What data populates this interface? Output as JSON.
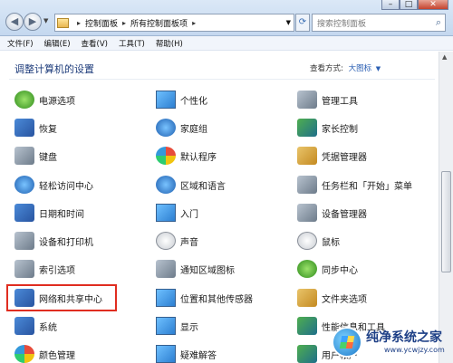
{
  "address_bar": {
    "crumbs": [
      "控制面板",
      "所有控制面板项"
    ],
    "search_placeholder": "搜索控制面板"
  },
  "menu": [
    "文件(F)",
    "编辑(E)",
    "查看(V)",
    "工具(T)",
    "帮助(H)"
  ],
  "content": {
    "heading": "调整计算机的设置",
    "view_by_label": "查看方式:",
    "view_by_value": "大图标"
  },
  "items": [
    {
      "label": "电源选项",
      "icon": "power-options-icon"
    },
    {
      "label": "个性化",
      "icon": "personalization-icon"
    },
    {
      "label": "管理工具",
      "icon": "admin-tools-icon"
    },
    {
      "label": "恢复",
      "icon": "recovery-icon"
    },
    {
      "label": "家庭组",
      "icon": "homegroup-icon"
    },
    {
      "label": "家长控制",
      "icon": "parental-controls-icon"
    },
    {
      "label": "键盘",
      "icon": "keyboard-icon"
    },
    {
      "label": "默认程序",
      "icon": "default-programs-icon"
    },
    {
      "label": "凭据管理器",
      "icon": "credential-manager-icon"
    },
    {
      "label": "轻松访问中心",
      "icon": "ease-of-access-icon"
    },
    {
      "label": "区域和语言",
      "icon": "region-language-icon"
    },
    {
      "label": "任务栏和「开始」菜单",
      "icon": "taskbar-start-icon"
    },
    {
      "label": "日期和时间",
      "icon": "date-time-icon"
    },
    {
      "label": "入门",
      "icon": "getting-started-icon"
    },
    {
      "label": "设备管理器",
      "icon": "device-manager-icon"
    },
    {
      "label": "设备和打印机",
      "icon": "devices-printers-icon"
    },
    {
      "label": "声音",
      "icon": "sound-icon"
    },
    {
      "label": "鼠标",
      "icon": "mouse-icon"
    },
    {
      "label": "索引选项",
      "icon": "indexing-options-icon"
    },
    {
      "label": "通知区域图标",
      "icon": "notification-icons-icon"
    },
    {
      "label": "同步中心",
      "icon": "sync-center-icon"
    },
    {
      "label": "网络和共享中心",
      "icon": "network-sharing-icon"
    },
    {
      "label": "位置和其他传感器",
      "icon": "location-sensors-icon"
    },
    {
      "label": "文件夹选项",
      "icon": "folder-options-icon"
    },
    {
      "label": "系统",
      "icon": "system-icon"
    },
    {
      "label": "显示",
      "icon": "display-icon"
    },
    {
      "label": "性能信息和工具",
      "icon": "performance-icon"
    },
    {
      "label": "颜色管理",
      "icon": "color-management-icon"
    },
    {
      "label": "疑难解答",
      "icon": "troubleshooting-icon"
    },
    {
      "label": "用户帐户",
      "icon": "user-accounts-icon"
    }
  ],
  "watermark": {
    "title": "纯净系统之家",
    "url": "www.ycwjzy.com"
  }
}
